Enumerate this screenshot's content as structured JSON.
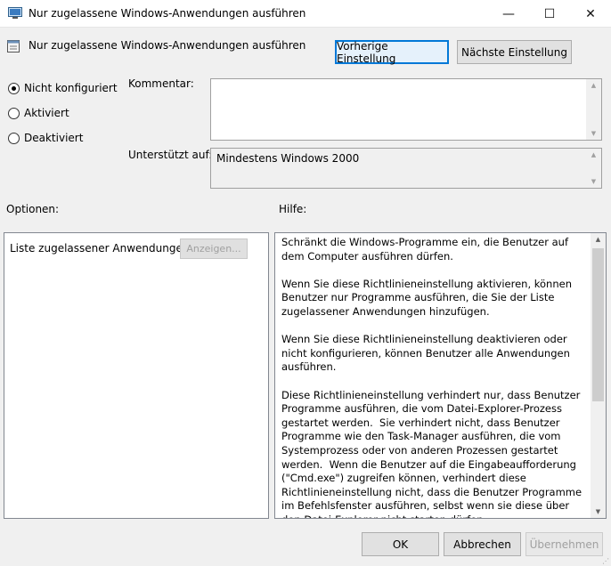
{
  "window": {
    "title": "Nur zugelassene Windows-Anwendungen ausführen",
    "controls": {
      "minimize": "—",
      "maximize": "☐",
      "close": "✕"
    }
  },
  "header": {
    "policy_name": "Nur zugelassene Windows-Anwendungen ausführen",
    "prev_button": "Vorherige Einstellung",
    "next_button": "Nächste Einstellung"
  },
  "state": {
    "options": [
      {
        "label": "Nicht konfiguriert",
        "selected": true
      },
      {
        "label": "Aktiviert",
        "selected": false
      },
      {
        "label": "Deaktiviert",
        "selected": false
      }
    ]
  },
  "comment": {
    "label": "Kommentar:",
    "value": ""
  },
  "supported": {
    "label": "Unterstützt auf:",
    "value": "Mindestens Windows 2000"
  },
  "options_section": {
    "label": "Optionen:",
    "list_label": "Liste zugelassener Anwendungen",
    "show_button": "Anzeigen..."
  },
  "help_section": {
    "label": "Hilfe:",
    "text": "Schränkt die Windows-Programme ein, die Benutzer auf dem Computer ausführen dürfen.\n\nWenn Sie diese Richtlinieneinstellung aktivieren, können Benutzer nur Programme ausführen, die Sie der Liste zugelassener Anwendungen hinzufügen.\n\nWenn Sie diese Richtlinieneinstellung deaktivieren oder nicht konfigurieren, können Benutzer alle Anwendungen ausführen.\n\nDiese Richtlinieneinstellung verhindert nur, dass Benutzer Programme ausführen, die vom Datei-Explorer-Prozess gestartet werden.  Sie verhindert nicht, dass Benutzer Programme wie den Task-Manager ausführen, die vom Systemprozess oder von anderen Prozessen gestartet werden.  Wenn die Benutzer auf die Eingabeaufforderung (\"Cmd.exe\") zugreifen können, verhindert diese Richtlinieneinstellung nicht, dass die Benutzer Programme im Befehlsfenster ausführen, selbst wenn sie diese über den Datei-Explorer nicht starten dürfen.\n\nHinweis: Diese Richtlinieneinstellung gilt auch für nicht von"
  },
  "footer": {
    "ok": "OK",
    "cancel": "Abbrechen",
    "apply": "Übernehmen"
  },
  "colors": {
    "focus": "#0078d7",
    "disabled_text": "#a0a0a0"
  }
}
